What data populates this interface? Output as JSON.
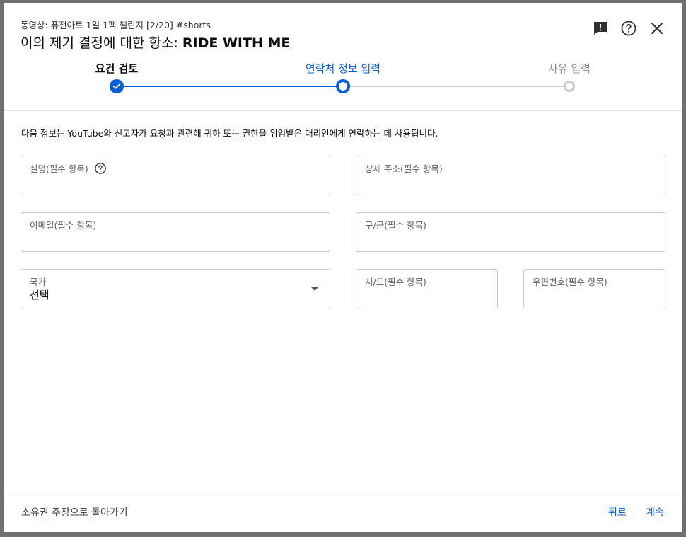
{
  "dialog": {
    "subtitle": "동영상: 퓨전아트 1일 1팩 챌린지 [2/20] #shorts",
    "title_prefix": "이의 제기 결정에 대한 항소: ",
    "title_strong": "RIDE WITH ME"
  },
  "header_icons": [
    "feedback-icon",
    "help-icon",
    "close-icon"
  ],
  "steps": [
    {
      "label": "요건 검토",
      "state": "done"
    },
    {
      "label": "연락처 정보 입력",
      "state": "active"
    },
    {
      "label": "사유 입력",
      "state": "pending"
    }
  ],
  "info_text": "다음 정보는 YouTube와 신고자가 요청과 관련해 귀하 또는 권한을 위임받은 대리인에게 연락하는 데 사용됩니다.",
  "form": {
    "full_name_label": "실명(필수 항목)",
    "address_label": "상세 주소(필수 항목)",
    "email_label": "이메일(필수 항목)",
    "district_label": "구/군(필수 항목)",
    "country_label": "국가",
    "country_value": "선택",
    "city_label": "시/도(필수 항목)",
    "postal_label": "우편번호(필수 항목)"
  },
  "footer": {
    "back_to_claim": "소유권 주장으로 돌아가기",
    "back": "뒤로",
    "continue": "계속"
  },
  "colors": {
    "accent": "#065fd4",
    "pending": "#cccccc",
    "border": "#c6c6c6"
  }
}
